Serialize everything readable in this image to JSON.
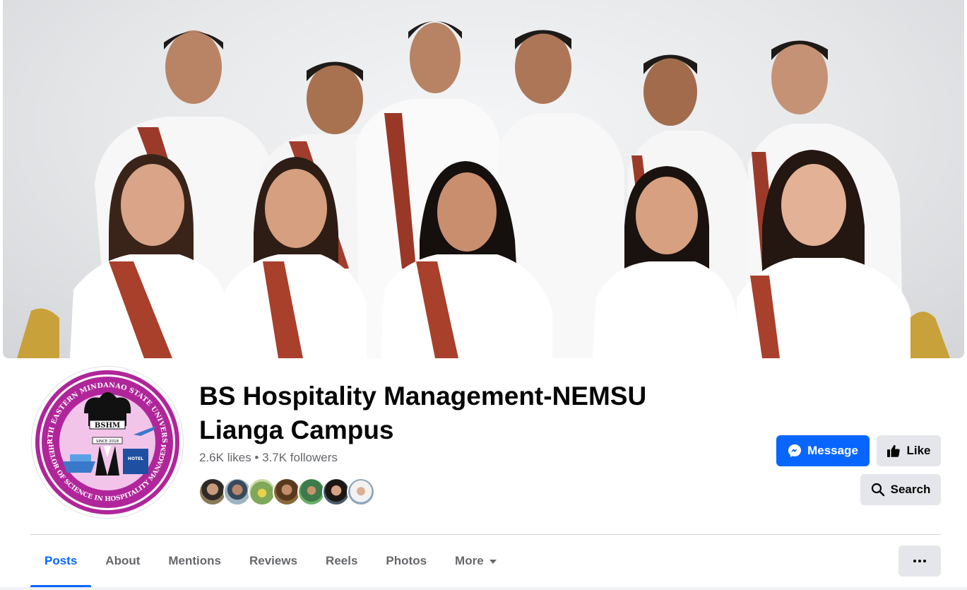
{
  "page": {
    "name": "BS Hospitality Management-NEMSU Lianga Campus",
    "likes": "2.6K likes",
    "separator": " • ",
    "followers": "3.7K followers"
  },
  "logo": {
    "ring_text_top": "NORTH EASTERN MINDANAO STATE UNIVERSITY",
    "ring_text_bottom": "BACHELOR OF SCIENCE IN HOSPITALITY MANAGEMENT",
    "badge": "BSHM",
    "since": "SINCE 2018",
    "hotel": "HOTEL"
  },
  "actions": {
    "message_label": "Message",
    "like_label": "Like",
    "search_label": "Search"
  },
  "tabs": [
    {
      "label": "Posts",
      "active": true
    },
    {
      "label": "About",
      "active": false
    },
    {
      "label": "Mentions",
      "active": false
    },
    {
      "label": "Reviews",
      "active": false
    },
    {
      "label": "Reels",
      "active": false
    },
    {
      "label": "Photos",
      "active": false
    },
    {
      "label": "More",
      "active": false
    }
  ],
  "friend_avatars": [
    "friend-1",
    "friend-2",
    "friend-3",
    "friend-4",
    "friend-5",
    "friend-6",
    "friend-7"
  ],
  "colors": {
    "accent": "#0866ff",
    "secondary_button": "#e4e6eb",
    "muted_text": "#65676b",
    "logo_pink": "#b0269a"
  }
}
